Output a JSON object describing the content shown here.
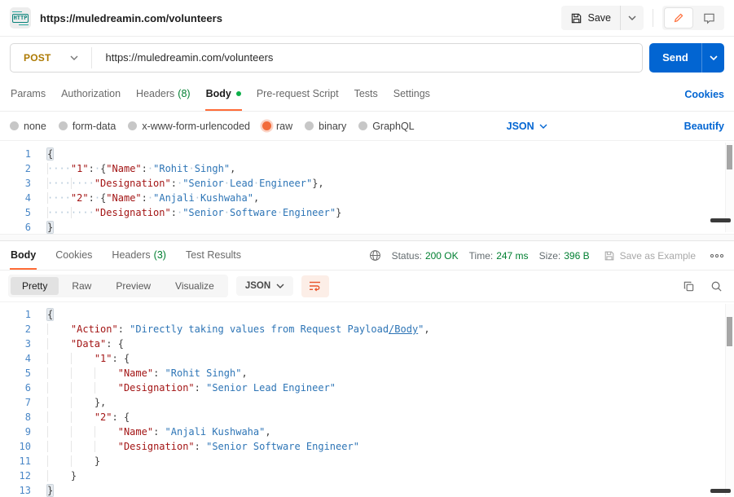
{
  "colors": {
    "accent_orange": "#ff6c37",
    "link_blue": "#0265d2",
    "success_green": "#007f31",
    "method_post": "#ad7a03"
  },
  "header": {
    "http_badge": "HTTP",
    "tab_title": "https://muledreamin.com/volunteers",
    "save_label": "Save"
  },
  "request": {
    "method": "POST",
    "url": "https://muledreamin.com/volunteers",
    "send_label": "Send",
    "tabs": [
      {
        "label": "Params"
      },
      {
        "label": "Authorization"
      },
      {
        "label": "Headers",
        "count": "(8)"
      },
      {
        "label": "Body"
      },
      {
        "label": "Pre-request Script"
      },
      {
        "label": "Tests"
      },
      {
        "label": "Settings"
      }
    ],
    "active_tab": "Body",
    "cookies_link": "Cookies",
    "body_types": [
      "none",
      "form-data",
      "x-www-form-urlencoded",
      "raw",
      "binary",
      "GraphQL"
    ],
    "selected_body_type": "raw",
    "raw_language": "JSON",
    "beautify_link": "Beautify"
  },
  "response": {
    "tabs": [
      {
        "label": "Body"
      },
      {
        "label": "Cookies"
      },
      {
        "label": "Headers",
        "count": "(3)"
      },
      {
        "label": "Test Results"
      }
    ],
    "active_tab": "Body",
    "status_label": "Status:",
    "status_value": "200 OK",
    "time_label": "Time:",
    "time_value": "247 ms",
    "size_label": "Size:",
    "size_value": "396 B",
    "save_as_example": "Save as Example",
    "view_tabs": [
      "Pretty",
      "Raw",
      "Preview",
      "Visualize"
    ],
    "active_view_tab": "Pretty",
    "language": "JSON"
  },
  "icons": [
    "http-badge-icon",
    "save-icon",
    "chevron-down-icon",
    "pencil-icon",
    "comment-icon",
    "globe-icon",
    "copy-icon",
    "search-icon",
    "wrap-text-icon",
    "more-options-icon"
  ],
  "request_editor": {
    "lines": [
      {
        "n": "1",
        "seg": [
          {
            "c": "hl",
            "t": "{"
          }
        ]
      },
      {
        "n": "2",
        "seg": [
          {
            "c": "w",
            "g": 1,
            "t": "····"
          },
          {
            "c": "k",
            "t": "\"1\""
          },
          {
            "c": "p",
            "t": ":"
          },
          {
            "c": "w",
            "t": "·"
          },
          {
            "c": "p",
            "t": "{"
          },
          {
            "c": "k",
            "t": "\"Name\""
          },
          {
            "c": "p",
            "t": ":"
          },
          {
            "c": "w",
            "t": "·"
          },
          {
            "c": "v",
            "t": "\"Rohit"
          },
          {
            "c": "w",
            "t": "·"
          },
          {
            "c": "v",
            "t": "Singh\""
          },
          {
            "c": "p",
            "t": ","
          }
        ]
      },
      {
        "n": "3",
        "seg": [
          {
            "c": "w",
            "g": 1,
            "t": "····"
          },
          {
            "c": "w",
            "g": 1,
            "t": "····"
          },
          {
            "c": "k",
            "t": "\"Designation\""
          },
          {
            "c": "p",
            "t": ":"
          },
          {
            "c": "w",
            "t": "·"
          },
          {
            "c": "v",
            "t": "\"Senior"
          },
          {
            "c": "w",
            "t": "·"
          },
          {
            "c": "v",
            "t": "Lead"
          },
          {
            "c": "w",
            "t": "·"
          },
          {
            "c": "v",
            "t": "Engineer\""
          },
          {
            "c": "p",
            "t": "},"
          }
        ]
      },
      {
        "n": "4",
        "seg": [
          {
            "c": "w",
            "g": 1,
            "t": "····"
          },
          {
            "c": "k",
            "t": "\"2\""
          },
          {
            "c": "p",
            "t": ":"
          },
          {
            "c": "w",
            "t": "·"
          },
          {
            "c": "p",
            "t": "{"
          },
          {
            "c": "k",
            "t": "\"Name\""
          },
          {
            "c": "p",
            "t": ":"
          },
          {
            "c": "w",
            "t": "·"
          },
          {
            "c": "v",
            "t": "\"Anjali"
          },
          {
            "c": "w",
            "t": "·"
          },
          {
            "c": "v",
            "t": "Kushwaha\""
          },
          {
            "c": "p",
            "t": ","
          }
        ]
      },
      {
        "n": "5",
        "seg": [
          {
            "c": "w",
            "g": 1,
            "t": "····"
          },
          {
            "c": "w",
            "g": 1,
            "t": "····"
          },
          {
            "c": "k",
            "t": "\"Designation\""
          },
          {
            "c": "p",
            "t": ":"
          },
          {
            "c": "w",
            "t": "·"
          },
          {
            "c": "v",
            "t": "\"Senior"
          },
          {
            "c": "w",
            "t": "·"
          },
          {
            "c": "v",
            "t": "Software"
          },
          {
            "c": "w",
            "t": "·"
          },
          {
            "c": "v",
            "t": "Engineer\""
          },
          {
            "c": "p",
            "t": "}"
          }
        ]
      },
      {
        "n": "6",
        "seg": [
          {
            "c": "hl",
            "t": "}"
          }
        ]
      }
    ]
  },
  "response_editor": {
    "lines": [
      {
        "n": "1",
        "seg": [
          {
            "c": "hl",
            "t": "{"
          }
        ]
      },
      {
        "n": "2",
        "seg": [
          {
            "c": "p",
            "g": 1,
            "t": "    "
          },
          {
            "c": "k",
            "t": "\"Action\""
          },
          {
            "c": "p",
            "t": ": "
          },
          {
            "c": "v",
            "t": "\"Directly taking values from Request Payload"
          },
          {
            "c": "u",
            "t": "/Body"
          },
          {
            "c": "v",
            "t": "\""
          },
          {
            "c": "p",
            "t": ","
          }
        ]
      },
      {
        "n": "3",
        "seg": [
          {
            "c": "p",
            "g": 1,
            "t": "    "
          },
          {
            "c": "k",
            "t": "\"Data\""
          },
          {
            "c": "p",
            "t": ": {"
          }
        ]
      },
      {
        "n": "4",
        "seg": [
          {
            "c": "p",
            "g": 1,
            "t": "    "
          },
          {
            "c": "p",
            "g": 1,
            "t": "    "
          },
          {
            "c": "k",
            "t": "\"1\""
          },
          {
            "c": "p",
            "t": ": {"
          }
        ]
      },
      {
        "n": "5",
        "seg": [
          {
            "c": "p",
            "g": 1,
            "t": "    "
          },
          {
            "c": "p",
            "g": 1,
            "t": "    "
          },
          {
            "c": "p",
            "g": 1,
            "t": "    "
          },
          {
            "c": "k",
            "t": "\"Name\""
          },
          {
            "c": "p",
            "t": ": "
          },
          {
            "c": "v",
            "t": "\"Rohit Singh\""
          },
          {
            "c": "p",
            "t": ","
          }
        ]
      },
      {
        "n": "6",
        "seg": [
          {
            "c": "p",
            "g": 1,
            "t": "    "
          },
          {
            "c": "p",
            "g": 1,
            "t": "    "
          },
          {
            "c": "p",
            "g": 1,
            "t": "    "
          },
          {
            "c": "k",
            "t": "\"Designation\""
          },
          {
            "c": "p",
            "t": ": "
          },
          {
            "c": "v",
            "t": "\"Senior Lead Engineer\""
          }
        ]
      },
      {
        "n": "7",
        "seg": [
          {
            "c": "p",
            "g": 1,
            "t": "    "
          },
          {
            "c": "p",
            "g": 1,
            "t": "    "
          },
          {
            "c": "p",
            "t": "},"
          }
        ]
      },
      {
        "n": "8",
        "seg": [
          {
            "c": "p",
            "g": 1,
            "t": "    "
          },
          {
            "c": "p",
            "g": 1,
            "t": "    "
          },
          {
            "c": "k",
            "t": "\"2\""
          },
          {
            "c": "p",
            "t": ": {"
          }
        ]
      },
      {
        "n": "9",
        "seg": [
          {
            "c": "p",
            "g": 1,
            "t": "    "
          },
          {
            "c": "p",
            "g": 1,
            "t": "    "
          },
          {
            "c": "p",
            "g": 1,
            "t": "    "
          },
          {
            "c": "k",
            "t": "\"Name\""
          },
          {
            "c": "p",
            "t": ": "
          },
          {
            "c": "v",
            "t": "\"Anjali Kushwaha\""
          },
          {
            "c": "p",
            "t": ","
          }
        ]
      },
      {
        "n": "10",
        "seg": [
          {
            "c": "p",
            "g": 1,
            "t": "    "
          },
          {
            "c": "p",
            "g": 1,
            "t": "    "
          },
          {
            "c": "p",
            "g": 1,
            "t": "    "
          },
          {
            "c": "k",
            "t": "\"Designation\""
          },
          {
            "c": "p",
            "t": ": "
          },
          {
            "c": "v",
            "t": "\"Senior Software Engineer\""
          }
        ]
      },
      {
        "n": "11",
        "seg": [
          {
            "c": "p",
            "g": 1,
            "t": "    "
          },
          {
            "c": "p",
            "g": 1,
            "t": "    "
          },
          {
            "c": "p",
            "t": "}"
          }
        ]
      },
      {
        "n": "12",
        "seg": [
          {
            "c": "p",
            "g": 1,
            "t": "    "
          },
          {
            "c": "p",
            "t": "}"
          }
        ]
      },
      {
        "n": "13",
        "seg": [
          {
            "c": "hl",
            "t": "}"
          }
        ]
      }
    ]
  }
}
